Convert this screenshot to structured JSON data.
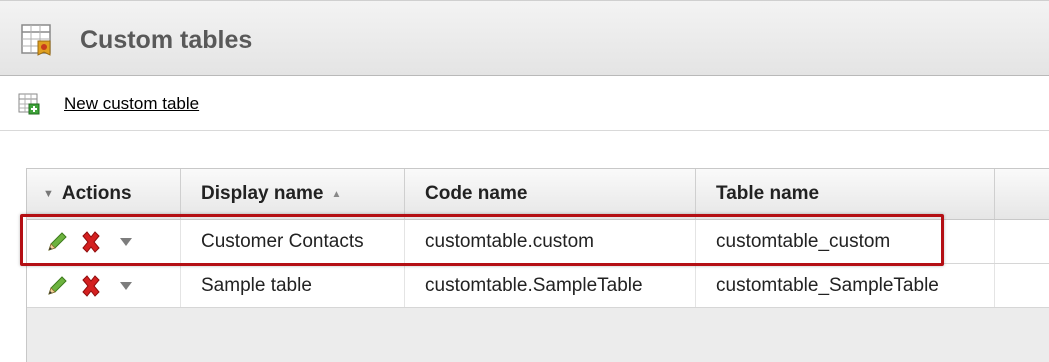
{
  "header": {
    "title": "Custom tables",
    "icon": "custom-table-icon"
  },
  "toolbar": {
    "new_label": "New custom table",
    "new_icon": "add-table-icon"
  },
  "grid": {
    "columns": {
      "actions": "Actions",
      "display_name": "Display name",
      "code_name": "Code name",
      "table_name": "Table name"
    },
    "sort": {
      "column": "display_name",
      "direction": "ascending"
    },
    "rows": [
      {
        "display_name": "Customer Contacts",
        "code_name": "customtable.custom",
        "table_name": "customtable_custom",
        "highlighted": true
      },
      {
        "display_name": "Sample table",
        "code_name": "customtable.SampleTable",
        "table_name": "customtable_SampleTable",
        "highlighted": false
      }
    ]
  },
  "colors": {
    "highlight_border": "#b40f14",
    "delete_icon": "#d42020",
    "edit_icon": "#5a9e2f",
    "header_title": "#595959"
  }
}
